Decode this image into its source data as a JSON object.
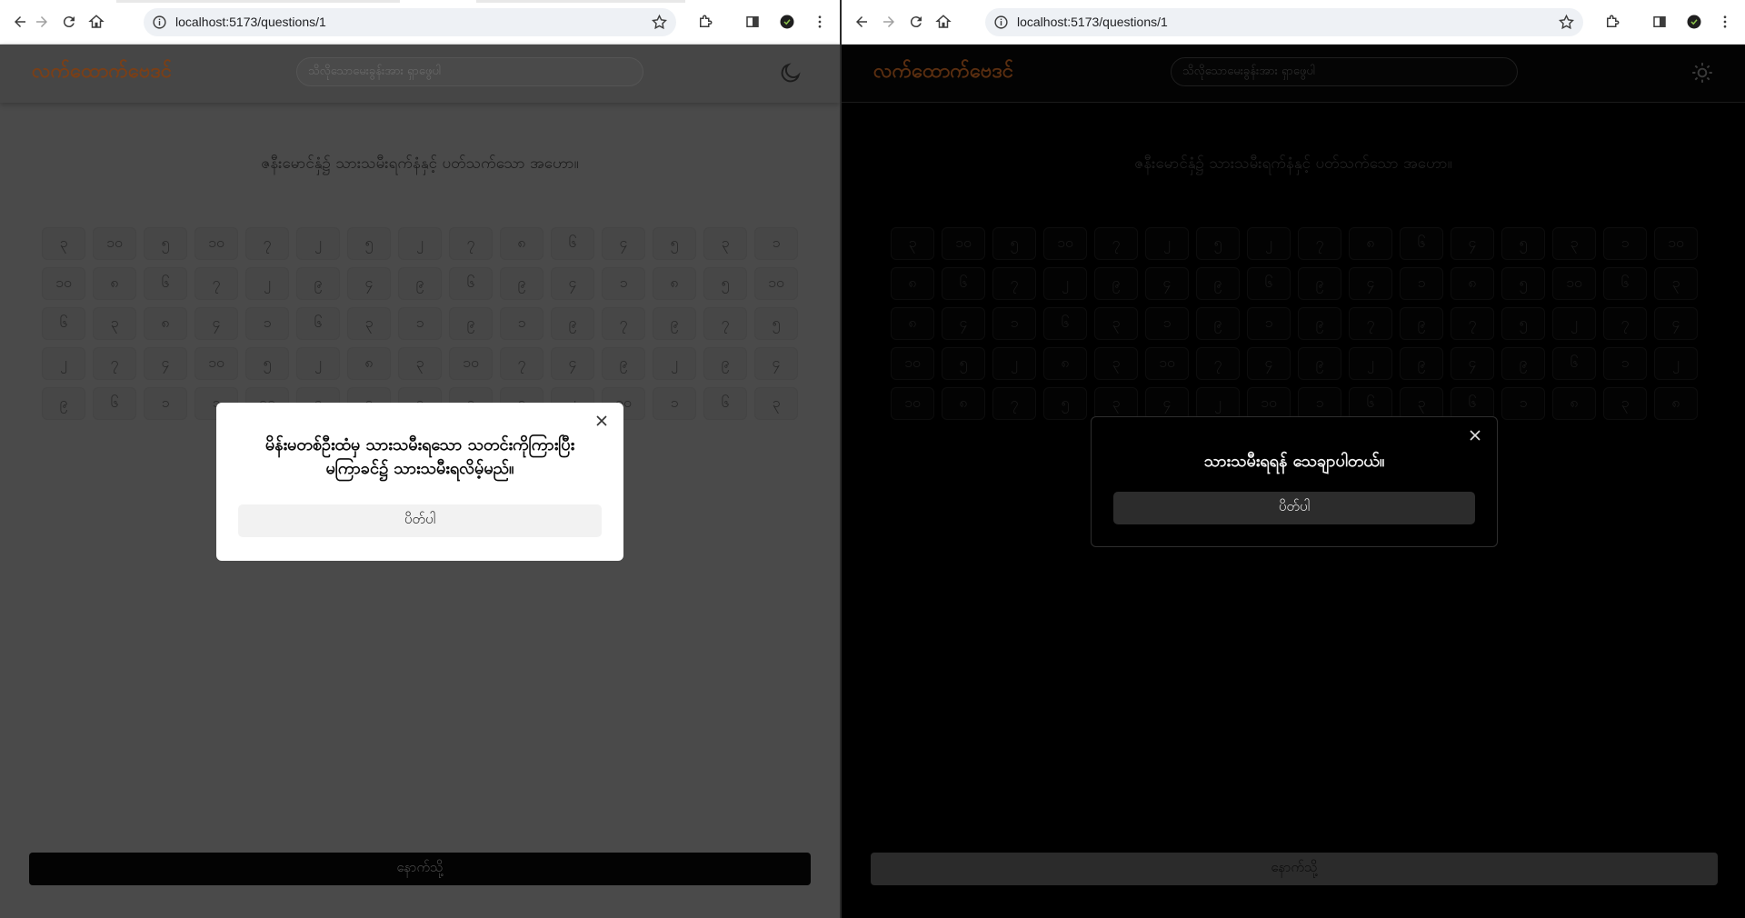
{
  "colors": {
    "brand_accent": "#7a3f17",
    "left_page_bg": "#4a4a4a",
    "right_page_bg": "#000000",
    "dialog_light_bg": "#ffffff",
    "dialog_dark_bg": "#000000"
  },
  "left": {
    "url": "localhost:5173/questions/1",
    "brand": "လက်ထောက်ဗေဒင်",
    "search_placeholder": "သိလိုသောမေးခွန်းအား ရှာဖွေပါ",
    "theme_icon": "moon-icon",
    "question": "ဇနီးမောင်နှံ၌ သားသမီးရက်နံနှင့် ပတ်သက်သော အဟော။",
    "grid_rows": [
      [
        "၃",
        "၁၀",
        "၅",
        "၁၀",
        "၇",
        "၂",
        "၅",
        "၂",
        "၇",
        "၈",
        "၆",
        "၄",
        "၅",
        "၃",
        "၁"
      ],
      [
        "၁၀",
        "၈",
        "၆",
        "၇",
        "၂",
        "၉",
        "၄",
        "၉",
        "၆",
        "၉",
        "၄",
        "၁",
        "၈",
        "၅",
        "၁၀"
      ],
      [
        "၆",
        "၃",
        "၈",
        "၄",
        "၁",
        "၆",
        "၃",
        "၁",
        "၉",
        "၁",
        "၉",
        "၇",
        "၉",
        "၇",
        "၅"
      ],
      [
        "၂",
        "၇",
        "၄",
        "၁၀",
        "၅",
        "၂",
        "၈",
        "၃",
        "၁၀",
        "၇",
        "၄",
        "၉",
        "၂",
        "၉",
        "၄"
      ],
      [
        "၉",
        "၆",
        "၁",
        "၁",
        "၁၀",
        "၉",
        "၃",
        "၅",
        "၅",
        "၈",
        "၂",
        "၁၀",
        "၁",
        "၆",
        "၃"
      ]
    ],
    "back_label": "နောက်သို့",
    "dialog": {
      "line1": "မိန်းမတစ်ဦးထံမှ သားသမီးရသော သတင်းကိုကြားပြီး",
      "line2": "မကြာခင်၌ သားသမီးရလိမ့်မည်။",
      "button": "ပိတ်ပါ"
    }
  },
  "right": {
    "url": "localhost:5173/questions/1",
    "brand": "လက်ထောက်ဗေဒင်",
    "search_placeholder": "သိလိုသောမေးခွန်းအား ရှာဖွေပါ",
    "theme_icon": "sun-icon",
    "question": "ဇနီးမောင်နှံ၌ သားသမီးရက်နံနှင့် ပတ်သက်သော အဟော။",
    "grid_rows": [
      [
        "၃",
        "၁၀",
        "၅",
        "၁၀",
        "၇",
        "၂",
        "၅",
        "၂",
        "၇",
        "၈",
        "၆",
        "၄",
        "၅",
        "၃",
        "၁",
        "၁၀"
      ],
      [
        "၈",
        "၆",
        "၇",
        "၂",
        "၉",
        "၄",
        "၉",
        "၆",
        "၉",
        "၄",
        "၁",
        "၈",
        "၅",
        "၁၀",
        "၆",
        "၃"
      ],
      [
        "၈",
        "၄",
        "၁",
        "၆",
        "၃",
        "၁",
        "၉",
        "၁",
        "၉",
        "၇",
        "၉",
        "၇",
        "၅",
        "၂",
        "၇",
        "၄"
      ],
      [
        "၁၀",
        "၅",
        "၂",
        "၈",
        "၃",
        "၁၀",
        "၇",
        "၄",
        "၉",
        "၂",
        "၉",
        "၄",
        "၉",
        "၆",
        "၁",
        "၂"
      ],
      [
        "၁၀",
        "၈",
        "၇",
        "၅",
        "၃",
        "၄",
        "၂",
        "၁၀",
        "၁",
        "၆",
        "၃",
        "၆",
        "၁",
        "၈",
        "၃",
        "၈"
      ]
    ],
    "back_label": "နောက်သို့",
    "dialog": {
      "line1": "သားသမီးရရန် သေချာပါတယ်။",
      "button": "ပိတ်ပါ"
    }
  }
}
